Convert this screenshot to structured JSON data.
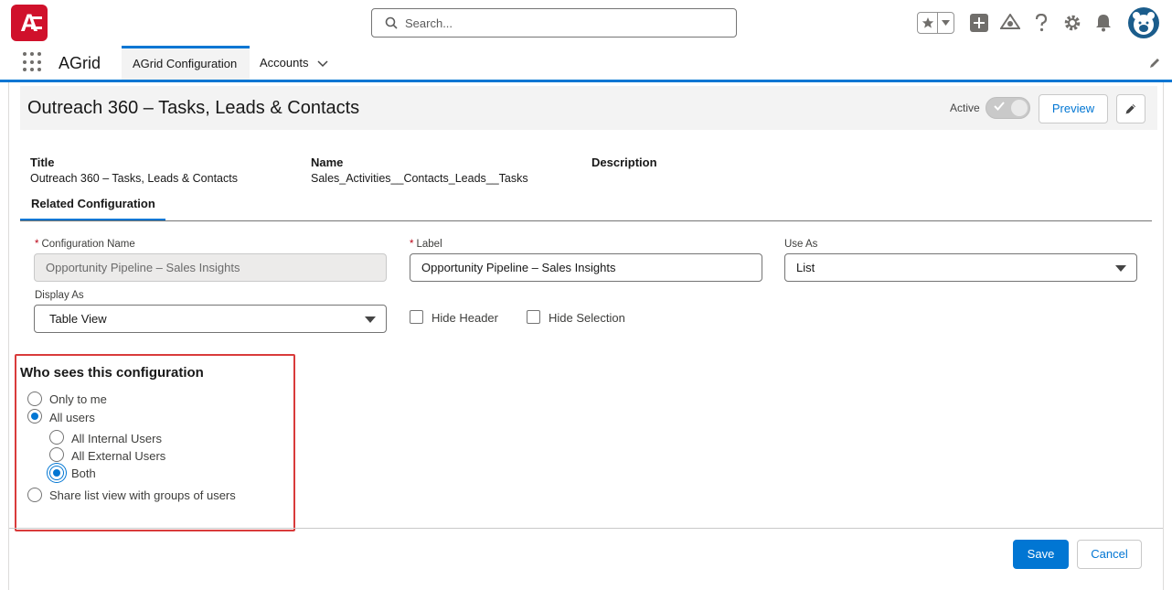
{
  "header": {
    "search_placeholder": "Search...",
    "icons": [
      "app-logo-icon",
      "search-icon",
      "star-icon",
      "chevron-down-icon",
      "add-icon",
      "trailhead-icon",
      "help-icon",
      "gear-icon",
      "bell-icon",
      "avatar"
    ]
  },
  "nav": {
    "app_name": "AGrid",
    "tabs": [
      {
        "label": "AGrid Configuration",
        "active": true
      },
      {
        "label": "Accounts",
        "active": false
      }
    ]
  },
  "record": {
    "title": "Outreach 360 – Tasks, Leads & Contacts",
    "active_label": "Active",
    "preview_label": "Preview",
    "fields": {
      "title_label": "Title",
      "title_value": "Outreach 360 – Tasks, Leads & Contacts",
      "name_label": "Name",
      "name_value": "Sales_Activities__Contacts_Leads__Tasks",
      "description_label": "Description"
    },
    "tab_related": "Related Configuration"
  },
  "form": {
    "config_name_label": "Configuration Name",
    "config_name_value": "Opportunity Pipeline – Sales Insights",
    "label_label": "Label",
    "label_value": "Opportunity Pipeline – Sales Insights",
    "use_as_label": "Use As",
    "use_as_value": "List",
    "display_as_label": "Display As",
    "display_as_value": "Table View",
    "hide_header_label": "Hide Header",
    "hide_selection_label": "Hide Selection",
    "required_mark": "*"
  },
  "visibility": {
    "title": "Who sees this configuration",
    "options": {
      "only_me": "Only to me",
      "all_users": "All users",
      "all_internal": "All Internal Users",
      "all_external": "All External Users",
      "both": "Both",
      "share_groups": "Share list view with groups of users"
    },
    "selected": "all_users",
    "sub_selected": "both"
  },
  "footer": {
    "save_label": "Save",
    "cancel_label": "Cancel"
  },
  "colors": {
    "brand_blue": "#0176d3",
    "logo_red": "#d0112b",
    "highlight_red": "#d93b3b"
  }
}
